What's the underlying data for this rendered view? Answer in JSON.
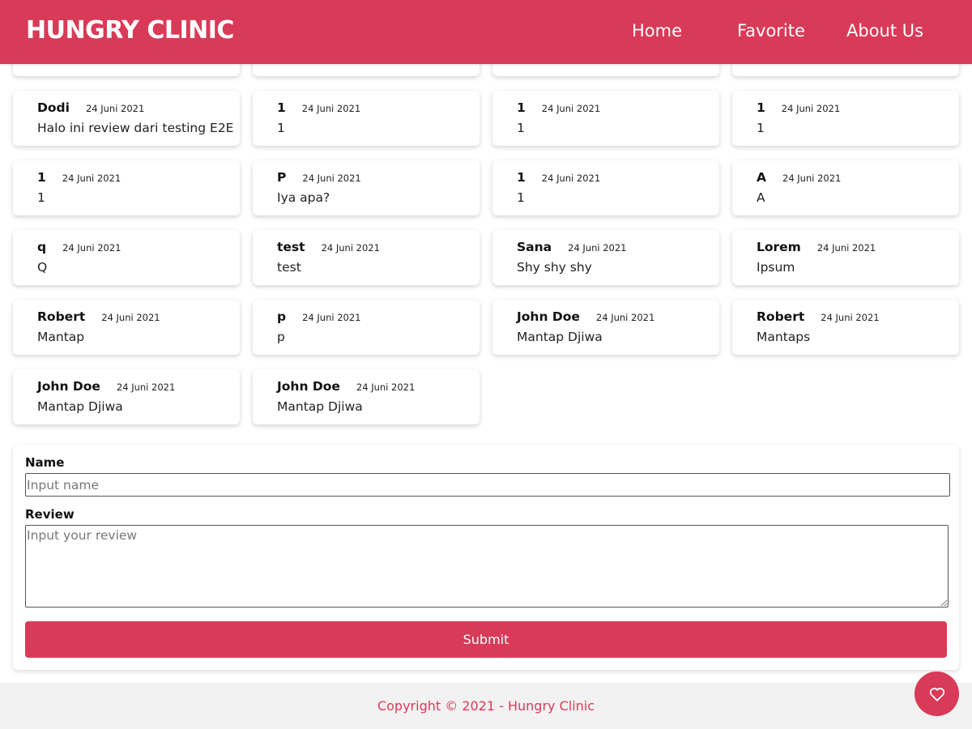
{
  "header": {
    "brand": "HUNGRY CLINIC",
    "nav": [
      "Home",
      "Favorite",
      "About Us"
    ],
    "color": "#d93a57"
  },
  "reviews_partial_top": [
    "",
    "",
    "(....)",
    ""
  ],
  "reviews": [
    {
      "name": "Dodi",
      "date": "24 Juni 2021",
      "text": "Halo ini review dari testing E2E"
    },
    {
      "name": "1",
      "date": "24 Juni 2021",
      "text": "1"
    },
    {
      "name": "1",
      "date": "24 Juni 2021",
      "text": "1"
    },
    {
      "name": "1",
      "date": "24 Juni 2021",
      "text": "1"
    },
    {
      "name": "1",
      "date": "24 Juni 2021",
      "text": "1"
    },
    {
      "name": "P",
      "date": "24 Juni 2021",
      "text": "Iya apa?"
    },
    {
      "name": "1",
      "date": "24 Juni 2021",
      "text": "1"
    },
    {
      "name": "A",
      "date": "24 Juni 2021",
      "text": "A"
    },
    {
      "name": "q",
      "date": "24 Juni 2021",
      "text": "Q"
    },
    {
      "name": "test",
      "date": "24 Juni 2021",
      "text": "test"
    },
    {
      "name": "Sana",
      "date": "24 Juni 2021",
      "text": "Shy shy shy"
    },
    {
      "name": "Lorem",
      "date": "24 Juni 2021",
      "text": "Ipsum"
    },
    {
      "name": "Robert",
      "date": "24 Juni 2021",
      "text": "Mantap"
    },
    {
      "name": "p",
      "date": "24 Juni 2021",
      "text": "p"
    },
    {
      "name": "John Doe",
      "date": "24 Juni 2021",
      "text": "Mantap Djiwa"
    },
    {
      "name": "Robert",
      "date": "24 Juni 2021",
      "text": "Mantaps"
    },
    {
      "name": "John Doe",
      "date": "24 Juni 2021",
      "text": "Mantap Djiwa"
    },
    {
      "name": "John Doe",
      "date": "24 Juni 2021",
      "text": "Mantap Djiwa"
    }
  ],
  "form": {
    "name_label": "Name",
    "name_placeholder": "Input name",
    "name_value": "",
    "review_label": "Review",
    "review_placeholder": "Input your review",
    "review_value": "",
    "submit_label": "Submit"
  },
  "footer": {
    "text": "Copyright © 2021 - Hungry Clinic"
  },
  "fab": {
    "icon": "heart-icon"
  }
}
